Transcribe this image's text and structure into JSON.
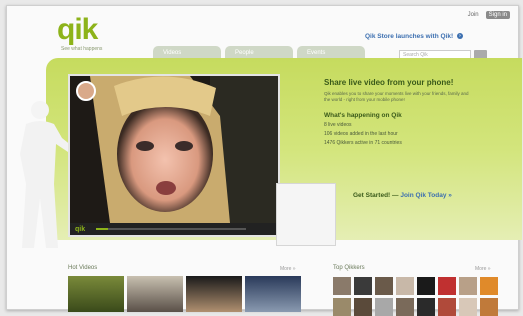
{
  "brand": {
    "logo": "qik",
    "tagline": "See what happens"
  },
  "topbar": {
    "login_label": "Join",
    "signin_label": "Sign in"
  },
  "promo": {
    "text": "Qik Store launches with Qik!",
    "icon": "info-icon"
  },
  "tabs": [
    {
      "label": "Videos"
    },
    {
      "label": "People"
    },
    {
      "label": "Events"
    }
  ],
  "search": {
    "placeholder": "Search Qik"
  },
  "hero": {
    "headline": "Share live video from your phone!",
    "blurb": "Qik enables you to share your moments live with your friends, family and the world - right from your mobile phone!",
    "subhead": "What's happening on Qik",
    "stats": [
      "8 live videos",
      "106 videos added in the last hour",
      "1476 Qikkers active in 71 countries"
    ],
    "cta_prefix": "Get Started! —",
    "cta_link": "Join Qik Today »",
    "player_brand": "qik",
    "progress": 0.08
  },
  "sections": {
    "hot_videos": {
      "title": "Hot Videos",
      "more": "More »"
    },
    "top_qikkers": {
      "title": "Top Qikkers",
      "more": "More »"
    }
  },
  "colors": {
    "accent": "#8db31a",
    "link": "#3c6fb0",
    "banner": "#c6db5e"
  }
}
